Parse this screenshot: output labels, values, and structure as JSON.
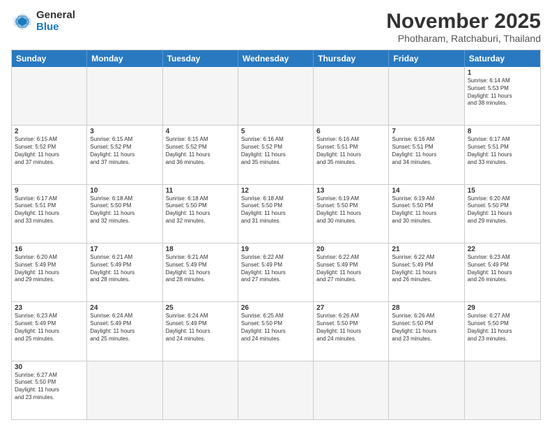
{
  "header": {
    "logo_general": "General",
    "logo_blue": "Blue",
    "month": "November 2025",
    "location": "Photharam, Ratchaburi, Thailand"
  },
  "weekdays": [
    "Sunday",
    "Monday",
    "Tuesday",
    "Wednesday",
    "Thursday",
    "Friday",
    "Saturday"
  ],
  "rows": [
    [
      {
        "day": "",
        "text": "",
        "empty": true
      },
      {
        "day": "",
        "text": "",
        "empty": true
      },
      {
        "day": "",
        "text": "",
        "empty": true
      },
      {
        "day": "",
        "text": "",
        "empty": true
      },
      {
        "day": "",
        "text": "",
        "empty": true
      },
      {
        "day": "",
        "text": "",
        "empty": true
      },
      {
        "day": "1",
        "text": "Sunrise: 6:14 AM\nSunset: 5:53 PM\nDaylight: 11 hours\nand 38 minutes.",
        "empty": false
      }
    ],
    [
      {
        "day": "2",
        "text": "Sunrise: 6:15 AM\nSunset: 5:52 PM\nDaylight: 11 hours\nand 37 minutes.",
        "empty": false
      },
      {
        "day": "3",
        "text": "Sunrise: 6:15 AM\nSunset: 5:52 PM\nDaylight: 11 hours\nand 37 minutes.",
        "empty": false
      },
      {
        "day": "4",
        "text": "Sunrise: 6:15 AM\nSunset: 5:52 PM\nDaylight: 11 hours\nand 36 minutes.",
        "empty": false
      },
      {
        "day": "5",
        "text": "Sunrise: 6:16 AM\nSunset: 5:52 PM\nDaylight: 11 hours\nand 35 minutes.",
        "empty": false
      },
      {
        "day": "6",
        "text": "Sunrise: 6:16 AM\nSunset: 5:51 PM\nDaylight: 11 hours\nand 35 minutes.",
        "empty": false
      },
      {
        "day": "7",
        "text": "Sunrise: 6:16 AM\nSunset: 5:51 PM\nDaylight: 11 hours\nand 34 minutes.",
        "empty": false
      },
      {
        "day": "8",
        "text": "Sunrise: 6:17 AM\nSunset: 5:51 PM\nDaylight: 11 hours\nand 33 minutes.",
        "empty": false
      }
    ],
    [
      {
        "day": "9",
        "text": "Sunrise: 6:17 AM\nSunset: 5:51 PM\nDaylight: 11 hours\nand 33 minutes.",
        "empty": false
      },
      {
        "day": "10",
        "text": "Sunrise: 6:18 AM\nSunset: 5:50 PM\nDaylight: 11 hours\nand 32 minutes.",
        "empty": false
      },
      {
        "day": "11",
        "text": "Sunrise: 6:18 AM\nSunset: 5:50 PM\nDaylight: 11 hours\nand 32 minutes.",
        "empty": false
      },
      {
        "day": "12",
        "text": "Sunrise: 6:18 AM\nSunset: 5:50 PM\nDaylight: 11 hours\nand 31 minutes.",
        "empty": false
      },
      {
        "day": "13",
        "text": "Sunrise: 6:19 AM\nSunset: 5:50 PM\nDaylight: 11 hours\nand 30 minutes.",
        "empty": false
      },
      {
        "day": "14",
        "text": "Sunrise: 6:19 AM\nSunset: 5:50 PM\nDaylight: 11 hours\nand 30 minutes.",
        "empty": false
      },
      {
        "day": "15",
        "text": "Sunrise: 6:20 AM\nSunset: 5:50 PM\nDaylight: 11 hours\nand 29 minutes.",
        "empty": false
      }
    ],
    [
      {
        "day": "16",
        "text": "Sunrise: 6:20 AM\nSunset: 5:49 PM\nDaylight: 11 hours\nand 29 minutes.",
        "empty": false
      },
      {
        "day": "17",
        "text": "Sunrise: 6:21 AM\nSunset: 5:49 PM\nDaylight: 11 hours\nand 28 minutes.",
        "empty": false
      },
      {
        "day": "18",
        "text": "Sunrise: 6:21 AM\nSunset: 5:49 PM\nDaylight: 11 hours\nand 28 minutes.",
        "empty": false
      },
      {
        "day": "19",
        "text": "Sunrise: 6:22 AM\nSunset: 5:49 PM\nDaylight: 11 hours\nand 27 minutes.",
        "empty": false
      },
      {
        "day": "20",
        "text": "Sunrise: 6:22 AM\nSunset: 5:49 PM\nDaylight: 11 hours\nand 27 minutes.",
        "empty": false
      },
      {
        "day": "21",
        "text": "Sunrise: 6:22 AM\nSunset: 5:49 PM\nDaylight: 11 hours\nand 26 minutes.",
        "empty": false
      },
      {
        "day": "22",
        "text": "Sunrise: 6:23 AM\nSunset: 5:49 PM\nDaylight: 11 hours\nand 26 minutes.",
        "empty": false
      }
    ],
    [
      {
        "day": "23",
        "text": "Sunrise: 6:23 AM\nSunset: 5:49 PM\nDaylight: 11 hours\nand 25 minutes.",
        "empty": false
      },
      {
        "day": "24",
        "text": "Sunrise: 6:24 AM\nSunset: 5:49 PM\nDaylight: 11 hours\nand 25 minutes.",
        "empty": false
      },
      {
        "day": "25",
        "text": "Sunrise: 6:24 AM\nSunset: 5:49 PM\nDaylight: 11 hours\nand 24 minutes.",
        "empty": false
      },
      {
        "day": "26",
        "text": "Sunrise: 6:25 AM\nSunset: 5:50 PM\nDaylight: 11 hours\nand 24 minutes.",
        "empty": false
      },
      {
        "day": "27",
        "text": "Sunrise: 6:26 AM\nSunset: 5:50 PM\nDaylight: 11 hours\nand 24 minutes.",
        "empty": false
      },
      {
        "day": "28",
        "text": "Sunrise: 6:26 AM\nSunset: 5:50 PM\nDaylight: 11 hours\nand 23 minutes.",
        "empty": false
      },
      {
        "day": "29",
        "text": "Sunrise: 6:27 AM\nSunset: 5:50 PM\nDaylight: 11 hours\nand 23 minutes.",
        "empty": false
      }
    ],
    [
      {
        "day": "30",
        "text": "Sunrise: 6:27 AM\nSunset: 5:50 PM\nDaylight: 11 hours\nand 23 minutes.",
        "empty": false
      },
      {
        "day": "",
        "text": "",
        "empty": true
      },
      {
        "day": "",
        "text": "",
        "empty": true
      },
      {
        "day": "",
        "text": "",
        "empty": true
      },
      {
        "day": "",
        "text": "",
        "empty": true
      },
      {
        "day": "",
        "text": "",
        "empty": true
      },
      {
        "day": "",
        "text": "",
        "empty": true
      }
    ]
  ]
}
